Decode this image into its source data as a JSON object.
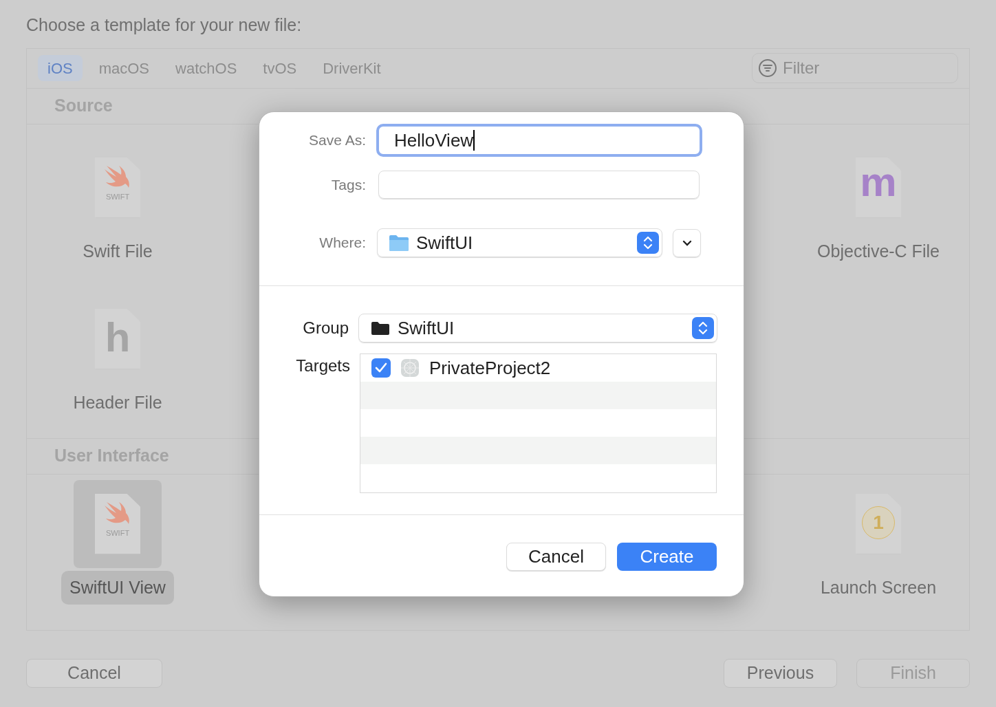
{
  "window": {
    "title": "Choose a template for your new file:"
  },
  "platform_tabs": [
    {
      "label": "iOS",
      "selected": true
    },
    {
      "label": "macOS",
      "selected": false
    },
    {
      "label": "watchOS",
      "selected": false
    },
    {
      "label": "tvOS",
      "selected": false
    },
    {
      "label": "DriverKit",
      "selected": false
    }
  ],
  "filter": {
    "placeholder": "Filter"
  },
  "sections": [
    {
      "title": "Source",
      "items": [
        {
          "name": "Swift File",
          "kind": "swift",
          "badge": "SWIFT",
          "selected": false
        },
        {
          "name": "Objective-C File",
          "kind": "objc",
          "badge": "m",
          "selected": false
        },
        {
          "name": "Header File",
          "kind": "header",
          "badge": "h",
          "selected": false
        }
      ]
    },
    {
      "title": "User Interface",
      "items": [
        {
          "name": "SwiftUI View",
          "kind": "swift",
          "badge": "SWIFT",
          "selected": true
        },
        {
          "name": "Launch Screen",
          "kind": "launch",
          "badge": "1",
          "selected": false
        }
      ]
    }
  ],
  "footer_buttons": [
    {
      "label": "Cancel",
      "disabled": false
    },
    {
      "label": "Previous",
      "disabled": false
    },
    {
      "label": "Finish",
      "disabled": true
    }
  ],
  "dialog": {
    "save_as": {
      "label": "Save As:",
      "value": "HelloView"
    },
    "tags": {
      "label": "Tags:"
    },
    "where": {
      "label": "Where:",
      "value": "SwiftUI"
    },
    "group": {
      "label": "Group",
      "value": "SwiftUI"
    },
    "targets": {
      "label": "Targets",
      "items": [
        {
          "name": "PrivateProject2",
          "checked": true
        }
      ]
    },
    "buttons": [
      {
        "label": "Cancel",
        "primary": false
      },
      {
        "label": "Create",
        "primary": true
      }
    ]
  }
}
